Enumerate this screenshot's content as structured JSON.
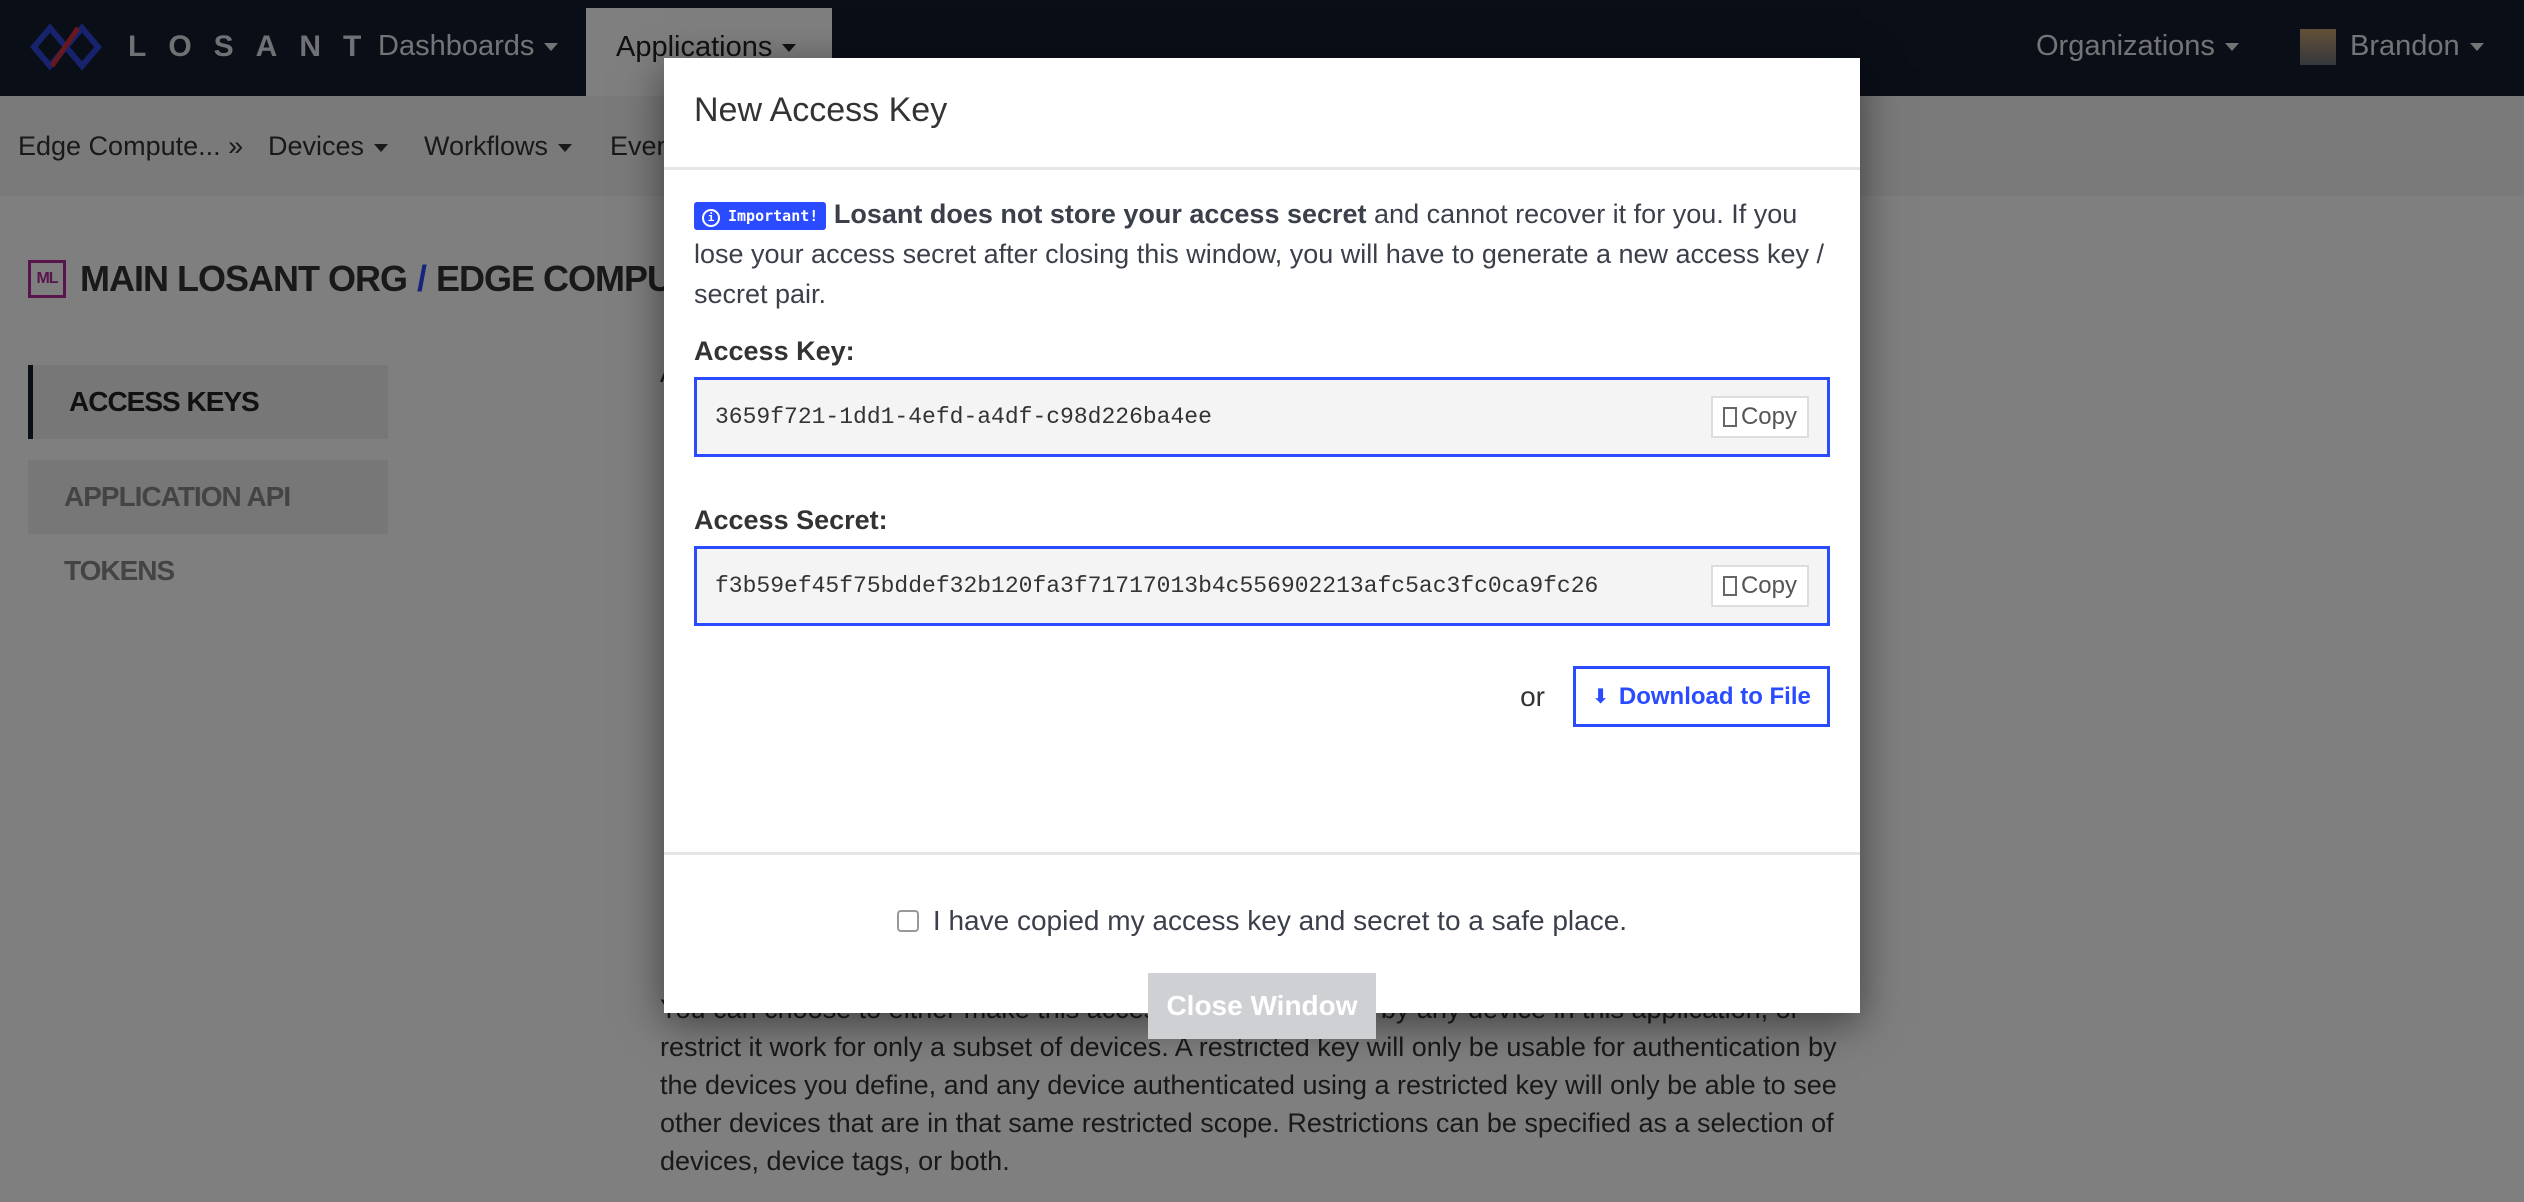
{
  "topnav": {
    "brand": "LOSANT",
    "items": [
      {
        "label": "Dashboards"
      },
      {
        "label": "Applications"
      }
    ],
    "organizations": "Organizations",
    "user": "Brandon"
  },
  "subnav": {
    "items": [
      "Edge Compute... »",
      "Devices",
      "Workflows",
      "Even"
    ]
  },
  "breadcrumb": {
    "org_badge": "ML",
    "org": "MAIN LOSANT ORG",
    "sep": "/",
    "app": "EDGE COMPUTE WALKT..."
  },
  "sidebar": {
    "items": [
      {
        "label": "ACCESS KEYS"
      },
      {
        "label": "APPLICATION API TOKENS"
      }
    ]
  },
  "background": {
    "heading_fragment": "A",
    "paragraph": "You can choose to either make this access key valid for use by any device in this application, or restrict it work for only a subset of devices. A restricted key will only be usable for authentication by the devices you define, and any device authenticated using a restricted key will only be able to see other devices that are in that same restricted scope. Restrictions can be specified as a selection of devices, device tags, or both."
  },
  "modal": {
    "title": "New Access Key",
    "badge": "Important!",
    "notice_bold": "Losant does not store your access secret",
    "notice_rest": " and cannot recover it for you. If you lose your access secret after closing this window, you will have to generate a new access key / secret pair.",
    "key_label": "Access Key:",
    "key_value": "3659f721-1dd1-4efd-a4df-c98d226ba4ee",
    "secret_label": "Access Secret:",
    "secret_value": "f3b59ef45f75bddef32b120fa3f71717013b4c556902213afc5ac3fc0ca9fc26",
    "copy_label": "Copy",
    "or": "or",
    "download_label": "Download to File",
    "checkbox_label": "I have copied my access key and secret to a safe place.",
    "checkbox_checked": false,
    "close_label": "Close Window"
  },
  "colors": {
    "accent": "#2a4bff",
    "nav": "#141c2e",
    "disabled_button": "#cfd0d4"
  }
}
